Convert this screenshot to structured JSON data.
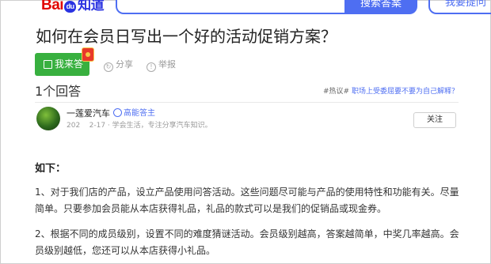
{
  "header": {
    "logo_text_bai": "Bai",
    "logo_text_du": "du",
    "logo_text_zhidao": "知道",
    "search_value": "",
    "search_button_label": "搜索答案",
    "ask_button_label": "我要提问"
  },
  "question": {
    "title": "如何在会员日写出一个好的活动促销方案？",
    "answer_button_label": "我来答",
    "share_label": "分享",
    "report_label": "举报"
  },
  "answers": {
    "count_label": "1个回答",
    "hot_tag": "#热议#",
    "hot_link": "职场上受委屈要不要为自己解释？"
  },
  "answerer": {
    "name": "一莲爱汽车",
    "badge_label": "高能答主",
    "meta": "202    2-17 · 学会生活，专注分享汽车知识。",
    "follow_label": "关注"
  },
  "content": {
    "heading": "如下：",
    "paragraphs": [
      "1、对于我们店的产品，设立产品使用问答活动。这些问题尽可能与产品的使用特性和功能有关。尽量简单。只要参加会员能从本店获得礼品，礼品的款式可以是我们的促销品或现金券。",
      "2、根据不同的成员级别，设置不同的难度猜谜活动。会员级别越高，答案越简单，中奖几率越高。会员级别越低，您还可以从本店获得小礼品。"
    ]
  },
  "colors": {
    "brand_red": "#e10601",
    "brand_blue": "#4e6ef2",
    "answer_green": "#38b03f"
  }
}
